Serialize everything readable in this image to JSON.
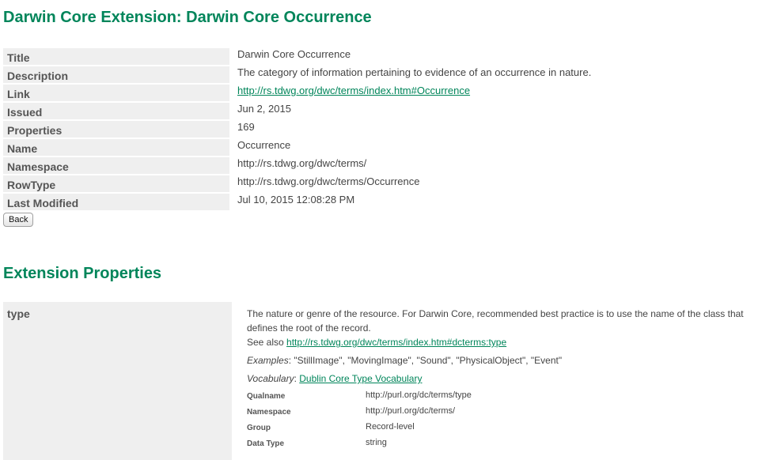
{
  "page_title": "Darwin Core Extension: Darwin Core Occurrence",
  "meta": {
    "title_label": "Title",
    "title_value": "Darwin Core Occurrence",
    "description_label": "Description",
    "description_value": "The category of information pertaining to evidence of an occurrence in nature.",
    "link_label": "Link",
    "link_value": "http://rs.tdwg.org/dwc/terms/index.htm#Occurrence",
    "issued_label": "Issued",
    "issued_value": "Jun 2, 2015",
    "properties_label": "Properties",
    "properties_value": "169",
    "name_label": "Name",
    "name_value": "Occurrence",
    "namespace_label": "Namespace",
    "namespace_value": "http://rs.tdwg.org/dwc/terms/",
    "rowtype_label": "RowType",
    "rowtype_value": "http://rs.tdwg.org/dwc/terms/Occurrence",
    "modified_label": "Last Modified",
    "modified_value": "Jul 10, 2015 12:08:28 PM"
  },
  "back_label": "Back",
  "section_title": "Extension Properties",
  "property": {
    "name": "type",
    "description": "The nature or genre of the resource. For Darwin Core, recommended best practice is to use the name of the class that defines the root of the record.",
    "see_also_label": "See also",
    "see_also_link": "http://rs.tdwg.org/dwc/terms/index.htm#dcterms:type",
    "examples_label": "Examples",
    "examples_value": ": \"StillImage\", \"MovingImage\", \"Sound\", \"PhysicalObject\", \"Event\"",
    "vocabulary_label": "Vocabulary",
    "vocabulary_sep": ": ",
    "vocabulary_link": "Dublin Core Type Vocabulary",
    "qualname_label": "Qualname",
    "qualname_value": "http://purl.org/dc/terms/type",
    "namespace_label": "Namespace",
    "namespace_value": "http://purl.org/dc/terms/",
    "group_label": "Group",
    "group_value": "Record-level",
    "datatype_label": "Data Type",
    "datatype_value": "string"
  }
}
